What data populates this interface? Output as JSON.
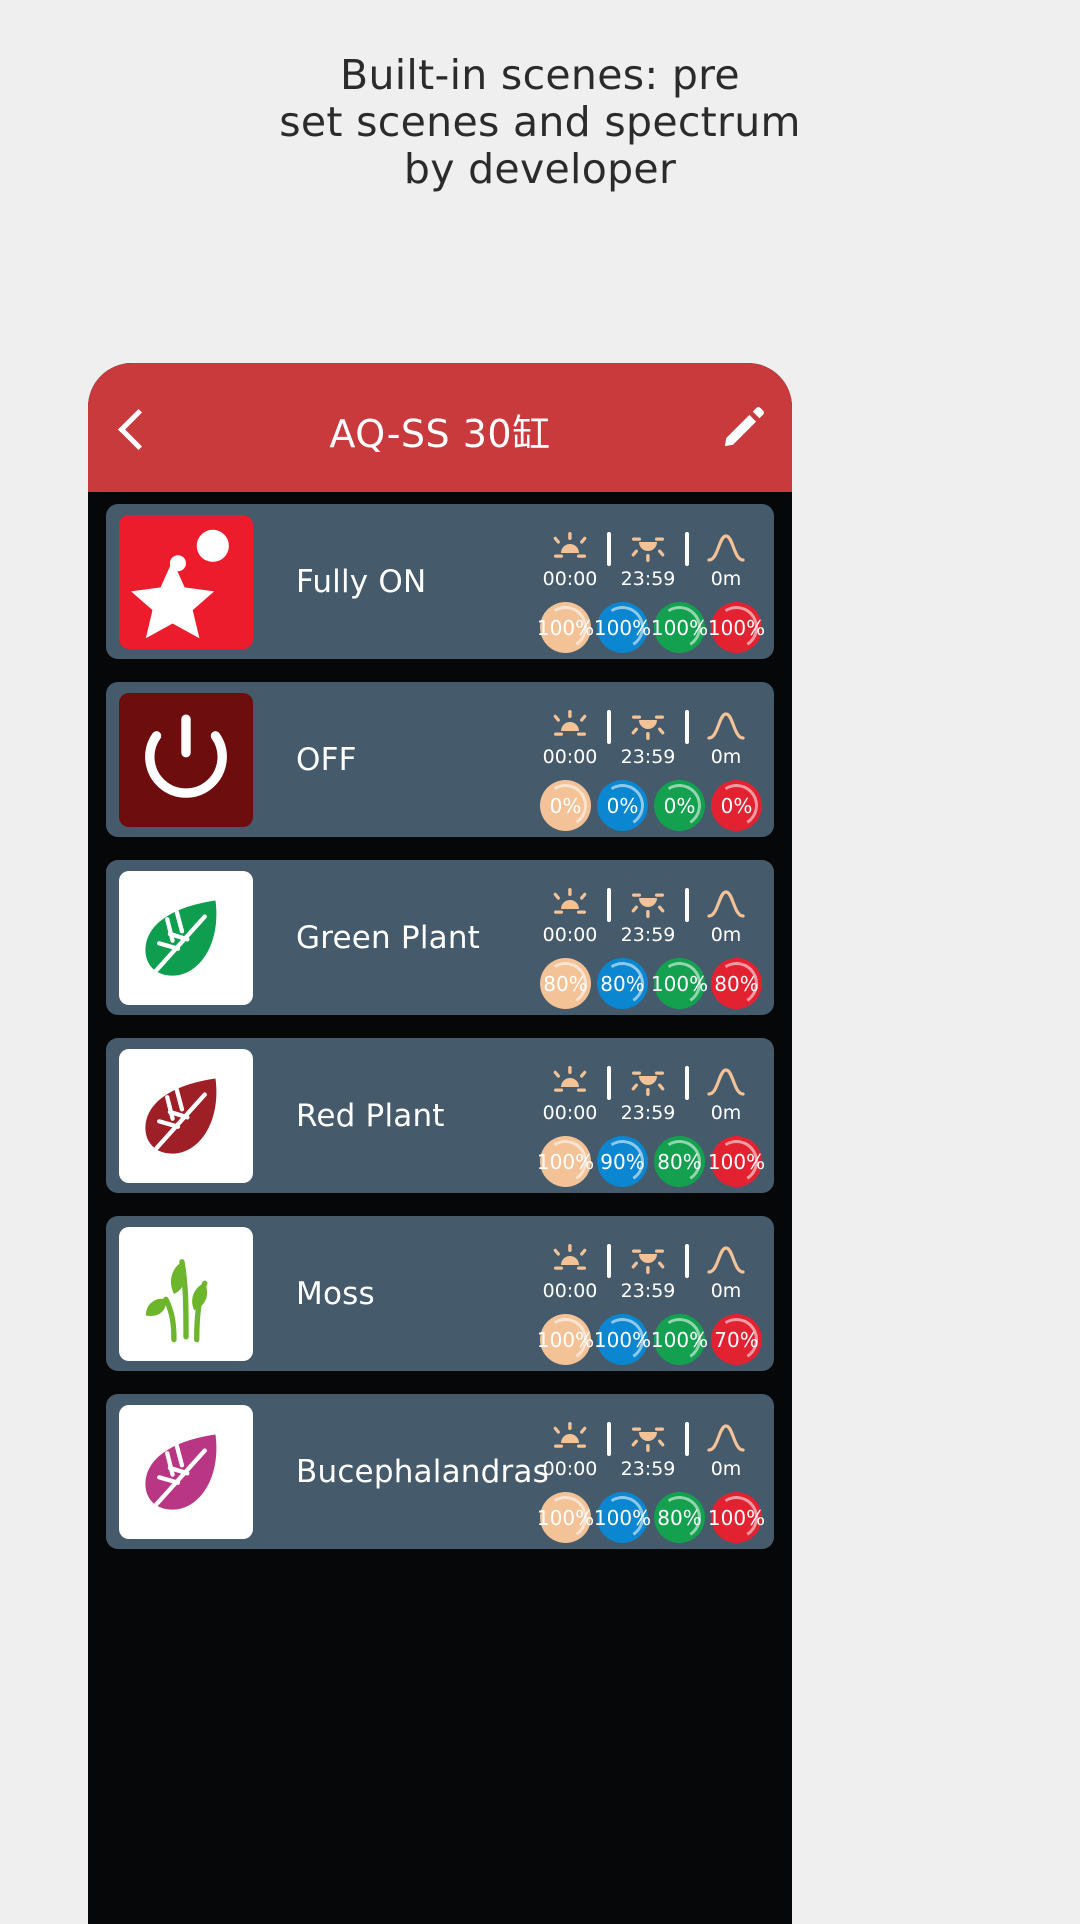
{
  "headline": {
    "lines": [
      "Built-in scenes: pre",
      "set scenes and spectrum",
      "by developer"
    ]
  },
  "appbar": {
    "title": "AQ-SS 30缸",
    "back_icon": "chevron-left-icon",
    "edit_icon": "pencil-icon",
    "bg_color": "#c93a3c"
  },
  "colors": {
    "page_bg": "#efefef",
    "phone_bg": "#050708",
    "row_bg": "#455a6b",
    "warm_white": "#f3c297",
    "blue": "#0b86d0",
    "green": "#13a14f",
    "red": "#e22231"
  },
  "timeline_icons": {
    "sunrise": "sunrise-icon",
    "sunset": "sunset-icon",
    "curve": "ramp-curve-icon"
  },
  "scenes": [
    {
      "name": "Fully ON",
      "icon": "star-splash-icon",
      "tile_bg": "#ec1c2c",
      "sunrise": "00:00",
      "sunset": "23:59",
      "ramp": "0m",
      "channels": [
        {
          "label": "100%",
          "color_key": "warm_white"
        },
        {
          "label": "100%",
          "color_key": "blue"
        },
        {
          "label": "100%",
          "color_key": "green"
        },
        {
          "label": "100%",
          "color_key": "red"
        }
      ]
    },
    {
      "name": "OFF",
      "icon": "power-icon",
      "tile_bg": "#6e0d0d",
      "sunrise": "00:00",
      "sunset": "23:59",
      "ramp": "0m",
      "channels": [
        {
          "label": "0%",
          "color_key": "warm_white"
        },
        {
          "label": "0%",
          "color_key": "blue"
        },
        {
          "label": "0%",
          "color_key": "green"
        },
        {
          "label": "0%",
          "color_key": "red"
        }
      ]
    },
    {
      "name": "Green Plant",
      "icon": "leaf-green-icon",
      "tile_bg": "#ffffff",
      "sunrise": "00:00",
      "sunset": "23:59",
      "ramp": "0m",
      "channels": [
        {
          "label": "80%",
          "color_key": "warm_white"
        },
        {
          "label": "80%",
          "color_key": "blue"
        },
        {
          "label": "100%",
          "color_key": "green"
        },
        {
          "label": "80%",
          "color_key": "red"
        }
      ]
    },
    {
      "name": "Red Plant",
      "icon": "leaf-red-icon",
      "tile_bg": "#ffffff",
      "sunrise": "00:00",
      "sunset": "23:59",
      "ramp": "0m",
      "channels": [
        {
          "label": "100%",
          "color_key": "warm_white"
        },
        {
          "label": "90%",
          "color_key": "blue"
        },
        {
          "label": "80%",
          "color_key": "green"
        },
        {
          "label": "100%",
          "color_key": "red"
        }
      ]
    },
    {
      "name": "Moss",
      "icon": "sprout-icon",
      "tile_bg": "#ffffff",
      "sunrise": "00:00",
      "sunset": "23:59",
      "ramp": "0m",
      "channels": [
        {
          "label": "100%",
          "color_key": "warm_white"
        },
        {
          "label": "100%",
          "color_key": "blue"
        },
        {
          "label": "100%",
          "color_key": "green"
        },
        {
          "label": "70%",
          "color_key": "red"
        }
      ]
    },
    {
      "name": "Bucephalandras",
      "icon": "leaf-magenta-icon",
      "tile_bg": "#ffffff",
      "sunrise": "00:00",
      "sunset": "23:59",
      "ramp": "0m",
      "channels": [
        {
          "label": "100%",
          "color_key": "warm_white"
        },
        {
          "label": "100%",
          "color_key": "blue"
        },
        {
          "label": "80%",
          "color_key": "green"
        },
        {
          "label": "100%",
          "color_key": "red"
        }
      ]
    }
  ]
}
